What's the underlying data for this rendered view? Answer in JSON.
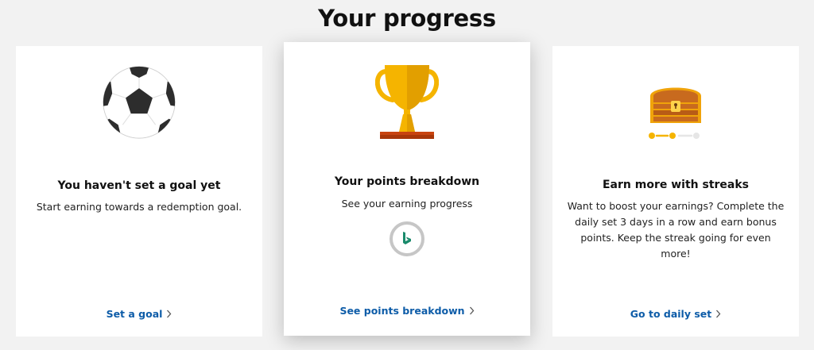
{
  "header": {
    "title": "Your progress"
  },
  "cards": [
    {
      "id": "goal",
      "icon": "soccer-ball-icon",
      "title": "You haven't set a goal yet",
      "description": "Start earning towards a redemption goal.",
      "link": "Set a goal"
    },
    {
      "id": "points",
      "icon": "trophy-icon",
      "title": "Your points breakdown",
      "description": "See your earning progress",
      "badge_icon": "bing-logo-icon",
      "link": "See points breakdown"
    },
    {
      "id": "streak",
      "icon": "treasure-chest-icon",
      "title": "Earn more with streaks",
      "description": "Want to boost your earnings? Complete the daily set 3 days in a row and earn bonus points. Keep the streak going for even more!",
      "streak_progress": {
        "completed": 2,
        "total": 3
      },
      "link": "Go to daily set"
    }
  ],
  "colors": {
    "link": "#0d5ca8",
    "trophy_gold": "#f5b400",
    "trophy_base": "#c8430f",
    "chest_wood": "#c86a1e",
    "streak_dot": "#f5b400",
    "bing_green": "#1a8a6b"
  }
}
